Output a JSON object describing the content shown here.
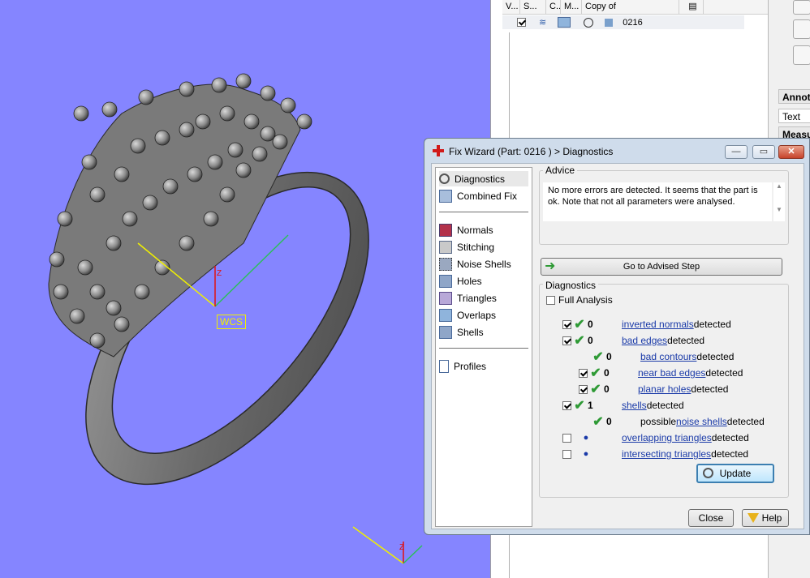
{
  "viewport": {
    "wcs_label": "WCS",
    "axis_z": "Z"
  },
  "parts_grid": {
    "columns": [
      "V...",
      "S...",
      "C...",
      "M...",
      "Copy of"
    ],
    "row": {
      "checked": true,
      "name": "0216"
    }
  },
  "side_panel": {
    "annotation_label": "Annota",
    "text_label": "Text",
    "measure_label": "Measu"
  },
  "dialog": {
    "title": "Fix Wizard (Part: 0216 ) > Diagnostics",
    "nav_top": [
      "Diagnostics",
      "Combined Fix"
    ],
    "nav_mid": [
      "Normals",
      "Stitching",
      "Noise Shells",
      "Holes",
      "Triangles",
      "Overlaps",
      "Shells"
    ],
    "nav_bottom": [
      "Profiles"
    ],
    "advice_title": "Advice",
    "advice_text": "No more errors are detected. It seems that the part is ok. Note that not all parameters were analysed.",
    "go_button": "Go to Advised Step",
    "diag_title": "Diagnostics",
    "full_analysis": "Full Analysis",
    "rows": [
      {
        "count": "0",
        "pre": "",
        "link": "inverted normals",
        "post": " detected"
      },
      {
        "count": "0",
        "pre": "",
        "link": "bad edges",
        "post": " detected"
      },
      {
        "count": "0",
        "pre": "",
        "link": "bad contours",
        "post": " detected"
      },
      {
        "count": "0",
        "pre": "",
        "link": "near bad edges",
        "post": " detected"
      },
      {
        "count": "0",
        "pre": "",
        "link": "planar holes",
        "post": " detected"
      },
      {
        "count": "1",
        "pre": "",
        "link": "shells",
        "post": " detected"
      },
      {
        "count": "0",
        "pre": "possible ",
        "link": "noise shells",
        "post": " detected"
      },
      {
        "count": "",
        "pre": "",
        "link": "overlapping triangles",
        "post": " detected"
      },
      {
        "count": "",
        "pre": "",
        "link": "intersecting triangles",
        "post": " detected"
      }
    ],
    "update_button": "Update",
    "close_button": "Close",
    "help_button": "Help"
  },
  "colors": {
    "viewport_bg": "#8585ff",
    "link": "#1a3aa8",
    "tick": "#2e9a35"
  }
}
